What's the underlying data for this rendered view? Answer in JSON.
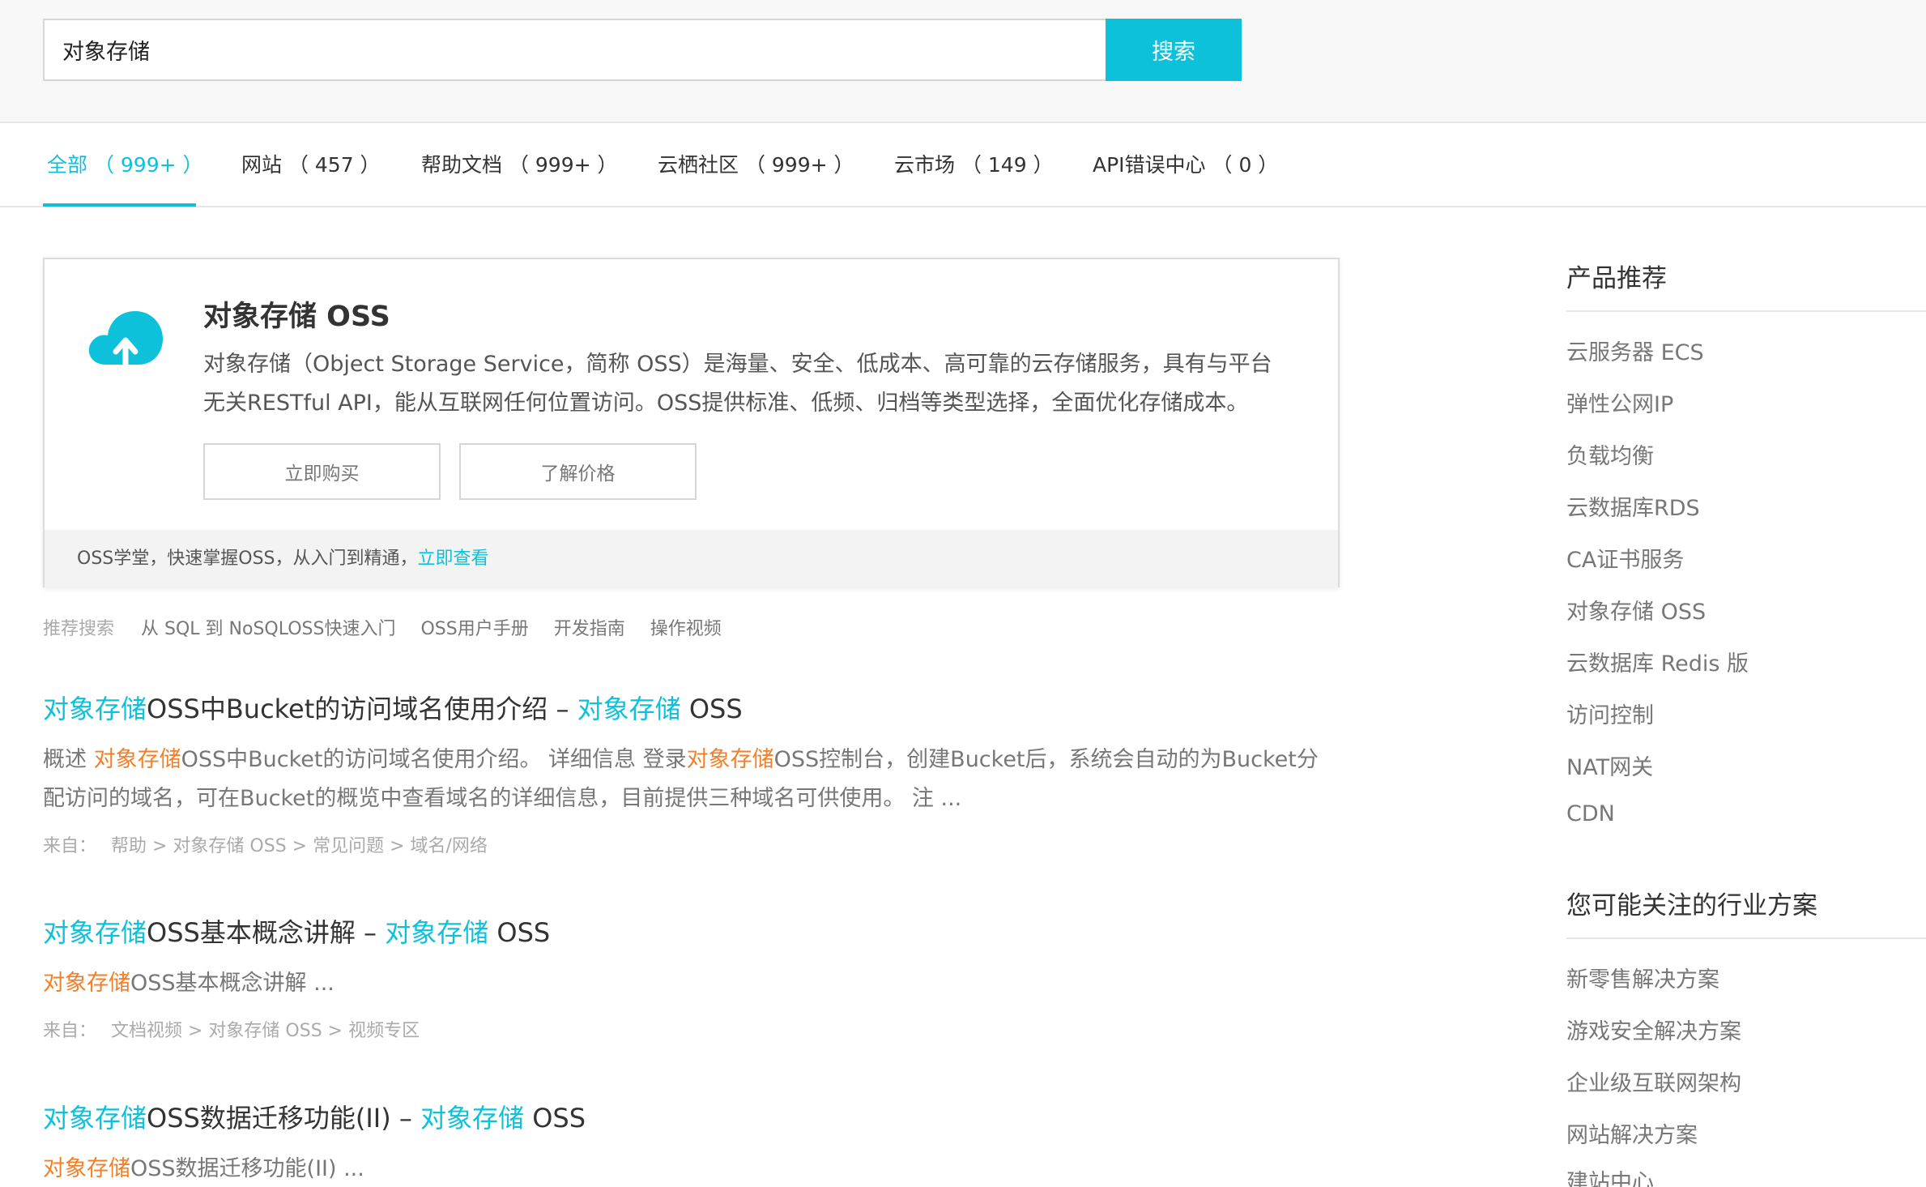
{
  "search": {
    "value": "对象存储",
    "button_label": "搜索"
  },
  "tabs": [
    {
      "label": "全部 （ 999+ ）",
      "active": true
    },
    {
      "label": "网站 （ 457 ）"
    },
    {
      "label": "帮助文档 （ 999+ ）"
    },
    {
      "label": "云栖社区 （ 999+ ）"
    },
    {
      "label": "云市场 （ 149 ）"
    },
    {
      "label": "API错误中心 （ 0 ）"
    }
  ],
  "card": {
    "icon": "cloud-upload-icon",
    "title": "对象存储 OSS",
    "description": "对象存储（Object Storage Service，简称 OSS）是海量、安全、低成本、高可靠的云存储服务，具有与平台无关RESTful API，能从互联网任何位置访问。OSS提供标准、低频、归档等类型选择，全面优化存储成本。",
    "buy_label": "立即购买",
    "price_label": "了解价格",
    "footer_text": "OSS学堂，快速掌握OSS，从入门到精通，",
    "footer_link": "立即查看"
  },
  "recommend": {
    "label": "推荐搜索",
    "items": [
      "从 SQL 到 NoSQLOSS快速入门",
      "OSS用户手册",
      "开发指南",
      "操作视频"
    ]
  },
  "results": [
    {
      "title_hl": "对象存储",
      "title_rest": "OSS中Bucket的访问域名使用介绍 – ",
      "title_hl2": "对象存储",
      "title_tail": " OSS",
      "snippet_a": "概述 ",
      "snippet_hl": "对象存储",
      "snippet_b": "OSS中Bucket的访问域名使用介绍。 详细信息 登录",
      "snippet_hl2": "对象存储",
      "snippet_c": "OSS控制台，创建Bucket后，系统会自动的为Bucket分配访问的域名，可在Bucket的概览中查看域名的详细信息，目前提供三种域名可供使用。 注 ...",
      "source_label": "来自：",
      "source_path": "帮助 > 对象存储 OSS > 常见问题 > 域名/网络"
    },
    {
      "title_hl": "对象存储",
      "title_rest": "OSS基本概念讲解 – ",
      "title_hl2": "对象存储",
      "title_tail": " OSS",
      "snippet_hl": "对象存储",
      "snippet_b": "OSS基本概念讲解 ...",
      "source_label": "来自：",
      "source_path": "文档视频 > 对象存储 OSS > 视频专区"
    },
    {
      "title_hl": "对象存储",
      "title_rest": "OSS数据迁移功能(II) – ",
      "title_hl2": "对象存储",
      "title_tail": " OSS",
      "snippet_hl": "对象存储",
      "snippet_b": "OSS数据迁移功能(II) ..."
    }
  ],
  "sidebar": {
    "products_title": "产品推荐",
    "products": [
      "云服务器 ECS",
      "弹性公网IP",
      "负载均衡",
      "云数据库RDS",
      "CA证书服务",
      "对象存储 OSS",
      "云数据库 Redis 版",
      "访问控制",
      "NAT网关",
      "CDN"
    ],
    "solutions_title": "您可能关注的行业方案",
    "solutions": [
      "新零售解决方案",
      "游戏安全解决方案",
      "企业级互联网架构",
      "网站解决方案",
      "建站中心"
    ]
  },
  "colors": {
    "accent": "#0ec1da",
    "highlight": "#f37f28"
  }
}
